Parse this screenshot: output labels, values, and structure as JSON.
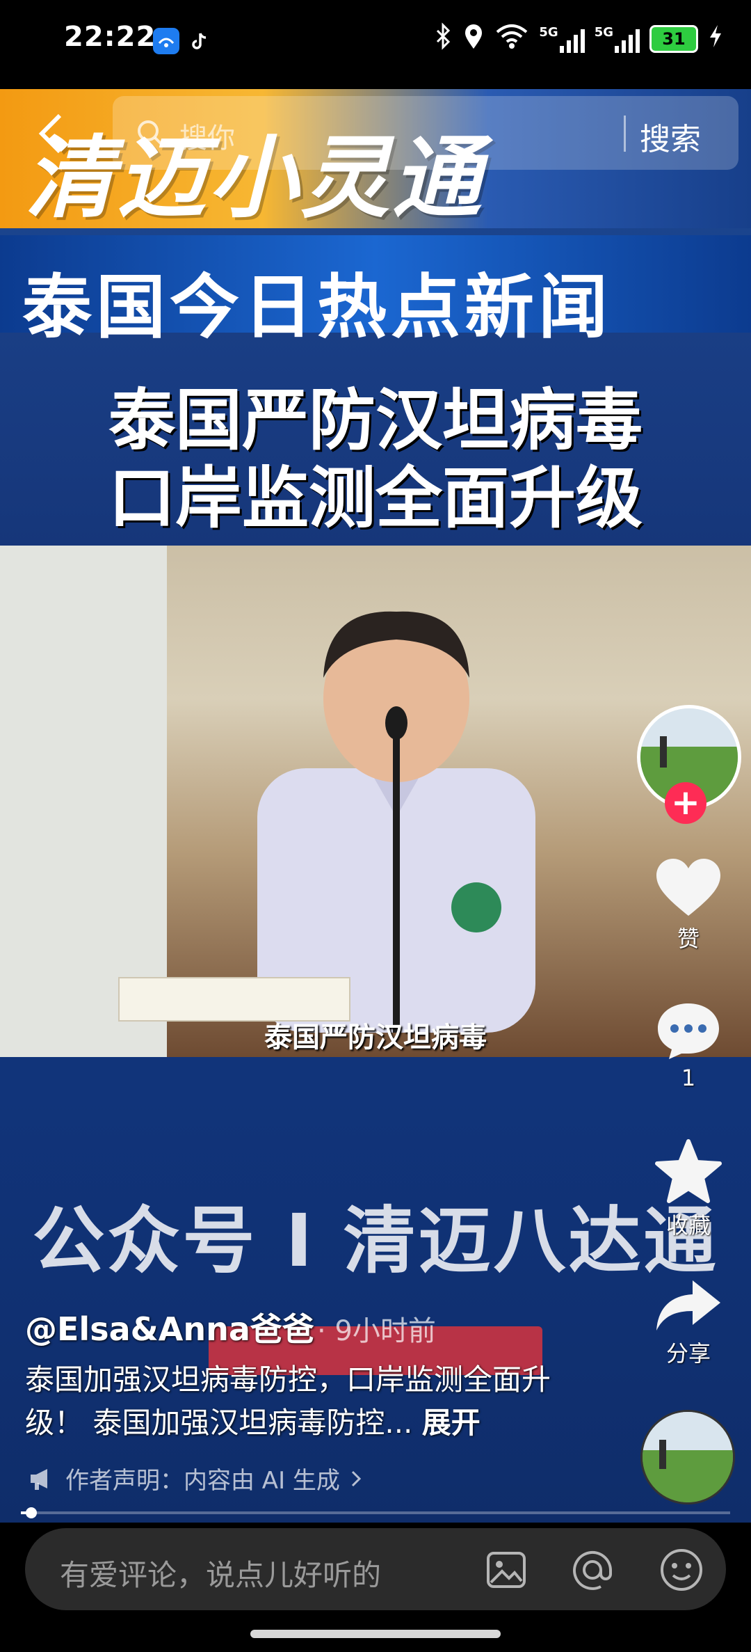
{
  "status_bar": {
    "time": "22:22",
    "network1": "5G",
    "network2": "5G",
    "battery": "31"
  },
  "search": {
    "placeholder": "搜你",
    "button_label": "搜索"
  },
  "video": {
    "brand_text": "清迈小灵通",
    "banner_text": "泰国今日热点新闻",
    "headline_line1": "泰国严防汉坦病毒",
    "headline_line2": "口岸监测全面升级",
    "subtitle": "泰国严防汉坦病毒",
    "watermark": "公众号 I 清迈八达通"
  },
  "rail": {
    "like_label": "赞",
    "comment_count": "1",
    "favorite_label": "收藏",
    "share_label": "分享"
  },
  "post": {
    "author": "@Elsa&Anna爸爸",
    "time": "· 9小时前",
    "description": "泰国加强汉坦病毒防控，口岸监测全面升级！ 泰国加强汉坦病毒防控...",
    "expand_label": "展开",
    "disclaimer": "作者声明：内容由 AI 生成"
  },
  "progress": {
    "fraction": 0.015
  },
  "comment_bar": {
    "placeholder": "有爱评论，说点儿好听的"
  },
  "colors": {
    "accent_red": "#fe2c55",
    "battery_green": "#2ecc40"
  }
}
